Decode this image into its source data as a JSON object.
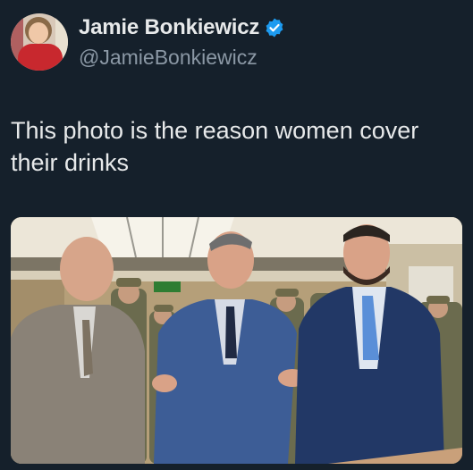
{
  "author": {
    "display_name": "Jamie Bonkiewicz",
    "handle": "@JamieBonkiewicz",
    "verified_icon": "verified-badge-icon",
    "verified_color": "#1d9bf0"
  },
  "tweet": {
    "text": "This photo is the reason women cover their drinks"
  },
  "colors": {
    "background": "#15202b",
    "text": "#e7e9ea",
    "secondary_text": "#8b98a5"
  }
}
